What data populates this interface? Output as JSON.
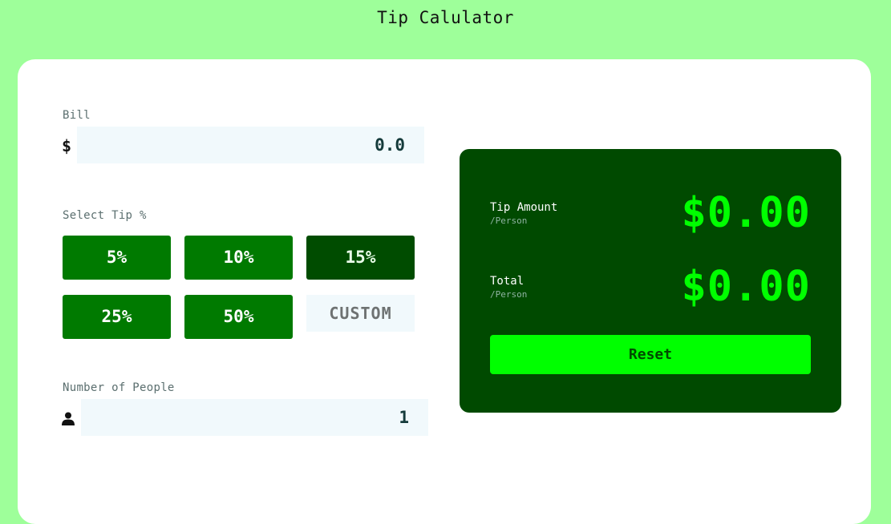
{
  "app": {
    "title": "Tip Calulator"
  },
  "bill": {
    "label": "Bill",
    "currency_symbol": "$",
    "value": "0.0"
  },
  "tip": {
    "label": "Select Tip %",
    "options": [
      "5%",
      "10%",
      "15%",
      "25%",
      "50%"
    ],
    "selected": "15%",
    "custom_placeholder": "CUSTOM"
  },
  "people": {
    "label": "Number of People",
    "value": "1",
    "icon": "person-icon"
  },
  "results": {
    "tip_amount_label": "Tip Amount",
    "tip_amount_sub": "/Person",
    "tip_amount_value": "$0.00",
    "total_label": "Total",
    "total_sub": "/Person",
    "total_value": "$0.00",
    "reset_label": "Reset"
  },
  "colors": {
    "page_bg": "#9eff9a",
    "accent": "#00ff00",
    "panel": "#004a00",
    "button": "#007a00",
    "button_active": "#004c00"
  }
}
